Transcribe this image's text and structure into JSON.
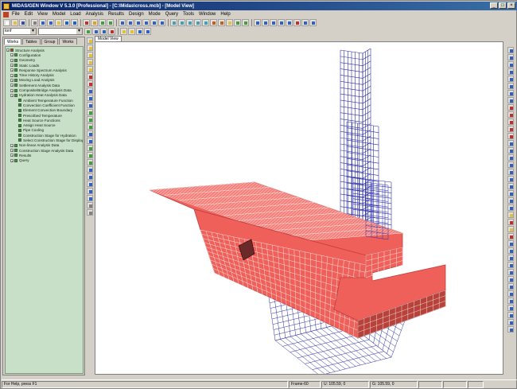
{
  "window": {
    "title": "MIDAS/GEN Window V 5.3.0 [Professional] - [C:\\Midas\\cross.mcb] - [Model View]",
    "min_glyph": "_",
    "max_glyph": "□",
    "close_glyph": "×"
  },
  "menu": [
    "File",
    "Edit",
    "View",
    "Model",
    "Load",
    "Analysis",
    "Results",
    "Design",
    "Mode",
    "Query",
    "Tools",
    "Window",
    "Help"
  ],
  "toolbar": {
    "unit_combo": "tonf",
    "second_combo": ""
  },
  "tree_tabs": [
    "Works",
    "Tables",
    "Group",
    "Works"
  ],
  "tree": [
    {
      "label": "Structure Analysis",
      "level": 0,
      "color": "#c04020"
    },
    {
      "label": "Configuration",
      "level": 1,
      "color": "#40a040"
    },
    {
      "label": "Geometry",
      "level": 1,
      "color": "#40a040"
    },
    {
      "label": "Static Loads",
      "level": 1,
      "color": "#40a040"
    },
    {
      "label": "Response Spectrum Analysis",
      "level": 1,
      "color": "#40a040"
    },
    {
      "label": "Time History Analysis",
      "level": 1,
      "color": "#40a040"
    },
    {
      "label": "Moving Load Analysis",
      "level": 1,
      "color": "#40a040"
    },
    {
      "label": "Settlement Analysis Data",
      "level": 1,
      "color": "#40a040"
    },
    {
      "label": "Composite/Bridge Analysis Data",
      "level": 1,
      "color": "#40a040"
    },
    {
      "label": "Hydration Heat Analysis Data",
      "level": 1,
      "color": "#40a040"
    },
    {
      "label": "Ambient Temperature Function",
      "level": 2,
      "color": "#309030"
    },
    {
      "label": "Convection Coefficient Function",
      "level": 2,
      "color": "#309030"
    },
    {
      "label": "Element Convection Boundary",
      "level": 2,
      "color": "#309030"
    },
    {
      "label": "Prescribed Temperature",
      "level": 2,
      "color": "#309030"
    },
    {
      "label": "Heat Source Functions",
      "level": 2,
      "color": "#309030"
    },
    {
      "label": "Assign Heat Source",
      "level": 2,
      "color": "#309030"
    },
    {
      "label": "Pipe Cooling",
      "level": 2,
      "color": "#309030"
    },
    {
      "label": "Construction Stage for Hydration",
      "level": 2,
      "color": "#309030"
    },
    {
      "label": "Select Construction Stage for Display",
      "level": 2,
      "color": "#309030"
    },
    {
      "label": "Non-linear Analysis Data",
      "level": 1,
      "color": "#40a040"
    },
    {
      "label": "Construction Stage Analysis Data",
      "level": 1,
      "color": "#40a040"
    },
    {
      "label": "Results",
      "level": 1,
      "color": "#40a040"
    },
    {
      "label": "Query",
      "level": 1,
      "color": "#40a040"
    }
  ],
  "view_tab": "Model View",
  "status": {
    "help": "For Help, press F1",
    "frame": "Frame-60",
    "coord1": "U: 105.59, 0",
    "coord2": "G: 105.59, 0"
  },
  "colors": {
    "slab_fill": "#f0605a",
    "slab_line": "#ffffff",
    "wire": "#2b2ea8",
    "tree_bg": "#c9e0c8"
  }
}
